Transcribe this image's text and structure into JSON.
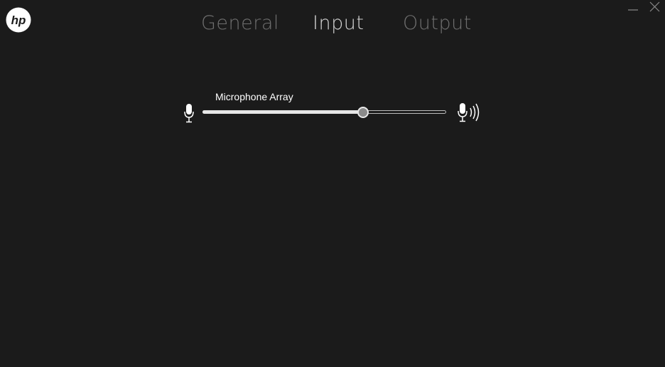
{
  "tabs": [
    {
      "label": "General",
      "active": false
    },
    {
      "label": "Input",
      "active": true
    },
    {
      "label": "Output",
      "active": false
    }
  ],
  "input": {
    "device_label": "Microphone Array",
    "volume_percent": 66
  },
  "icons": {
    "logo": "hp-logo",
    "minimize": "minimize-icon",
    "close": "close-icon",
    "mic_low": "microphone-low-icon",
    "mic_high": "microphone-high-icon"
  },
  "colors": {
    "background": "#1b1b1b",
    "tab_active": "#d4d4d4",
    "tab_inactive": "#6f6f6f",
    "slider_fill": "#e6e6e6"
  }
}
